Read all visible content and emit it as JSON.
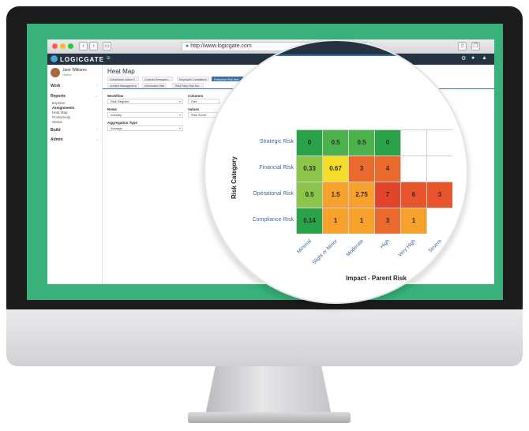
{
  "browser": {
    "url": "http://www.logicgate.com"
  },
  "app": {
    "logo_text": "LOGICGATE",
    "user": {
      "name": "Jane Williams",
      "status": "Online"
    },
    "sidebar": {
      "items": [
        {
          "label": "Work"
        },
        {
          "label": "Reports"
        },
        {
          "label": "Build"
        },
        {
          "label": "Admin"
        }
      ],
      "report_subitems": [
        "Explorer",
        "Assignments",
        "Heat Map",
        "Productivity",
        "Status"
      ]
    },
    "page_title": "Heat Map",
    "tabs": [
      {
        "label": "Compliance Active F...",
        "active": false
      },
      {
        "label": "Controls Emergenc...",
        "active": false
      },
      {
        "label": "Employee Compliance",
        "active": false
      },
      {
        "label": "Enterprise Risk Man...",
        "active": true
      },
      {
        "label": "Incident Management",
        "active": false
      },
      {
        "label": "Information Risk",
        "active": false
      },
      {
        "label": "Third Party Risk Ma...",
        "active": false
      }
    ],
    "filters": {
      "workflow_label": "Workflow",
      "workflow_value": "Risk Register",
      "columns_label": "Columns",
      "columns_value": "Oee",
      "rows_label": "Rows",
      "rows_value": "Industry",
      "values_label": "Values",
      "values_value": "Risk Score",
      "aggregation_label": "Aggregation Type",
      "aggregation_value": "Average"
    }
  },
  "chart_data": {
    "type": "heatmap",
    "title": "",
    "xlabel": "Impact - Parent Risk",
    "ylabel": "Risk Category",
    "x_categories": [
      "Minimal",
      "Slight or Minor",
      "Moderate",
      "High",
      "Very High",
      "Severe"
    ],
    "y_categories": [
      "Strategic Risk",
      "Financial Risk",
      "Operational Risk",
      "Compliance Risk"
    ],
    "values": [
      [
        "0",
        "0.5",
        "0.5",
        "0",
        "",
        ""
      ],
      [
        "0.33",
        "0.67",
        "3",
        "4",
        "",
        ""
      ],
      [
        "0.5",
        "1.5",
        "2.75",
        "7",
        "6",
        "3"
      ],
      [
        "0.14",
        "1",
        "1",
        "3",
        "1",
        ""
      ]
    ],
    "colors": [
      [
        "#2aa24a",
        "#4cb24c",
        "#4cb24c",
        "#2aa24a",
        "#ffffff",
        "#ffffff"
      ],
      [
        "#8cc54a",
        "#f5dd2a",
        "#ea6a2e",
        "#ea6a2e",
        "#ffffff",
        "#ffffff"
      ],
      [
        "#8cc54a",
        "#f6a12c",
        "#f6a12c",
        "#e2452c",
        "#e8552d",
        "#e8552d"
      ],
      [
        "#2aa24a",
        "#f6a12c",
        "#f6a12c",
        "#ea6a2e",
        "#f6a12c",
        "#ffffff"
      ]
    ]
  }
}
